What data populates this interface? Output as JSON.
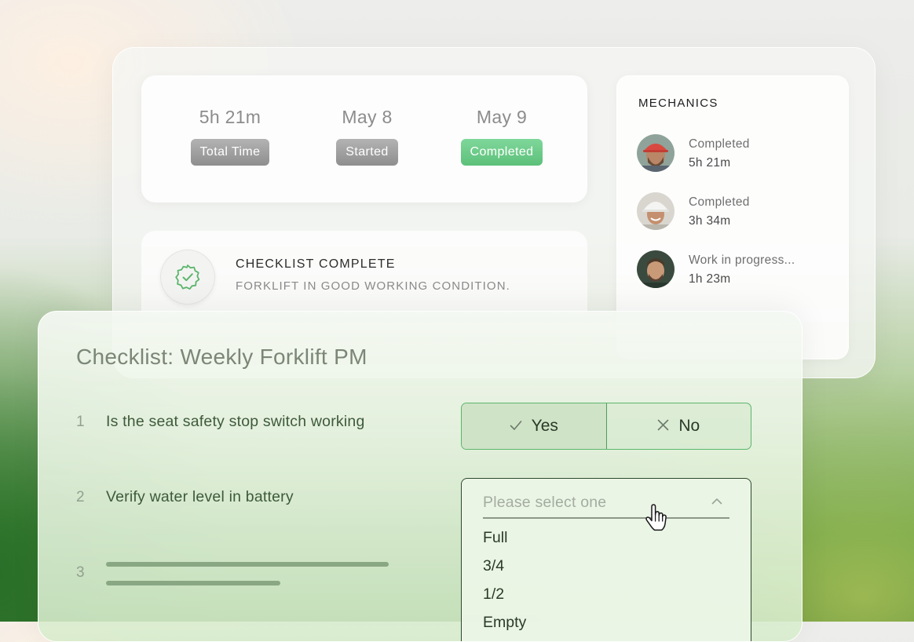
{
  "stats": [
    {
      "value": "5h 21m",
      "label": "Total Time",
      "style": "gray"
    },
    {
      "value": "May 8",
      "label": "Started",
      "style": "gray"
    },
    {
      "value": "May 9",
      "label": "Completed",
      "style": "green"
    }
  ],
  "checklist_status": {
    "title": "CHECKLIST COMPLETE",
    "subtitle": "FORKLIFT IN GOOD WORKING CONDITION.",
    "icon": "verified-badge-icon"
  },
  "mechanics": {
    "title": "MECHANICS",
    "items": [
      {
        "status": "Completed",
        "time": "5h 21m"
      },
      {
        "status": "Completed",
        "time": "3h 34m"
      },
      {
        "status": "Work in progress...",
        "time": "1h 23m"
      }
    ]
  },
  "checklist": {
    "title": "Checklist: Weekly Forklift PM",
    "questions": [
      {
        "number": "1",
        "text": "Is the seat safety stop switch working"
      },
      {
        "number": "2",
        "text": "Verify water level in battery"
      },
      {
        "number": "3",
        "text": ""
      }
    ],
    "yes_label": "Yes",
    "no_label": "No",
    "dropdown": {
      "placeholder": "Please select one",
      "options": [
        "Full",
        "3/4",
        "1/2",
        "Empty"
      ]
    }
  },
  "colors": {
    "accent_green": "#5cc07a",
    "border_green": "#5cb56c",
    "text_dark_green": "#3d5a3a"
  }
}
